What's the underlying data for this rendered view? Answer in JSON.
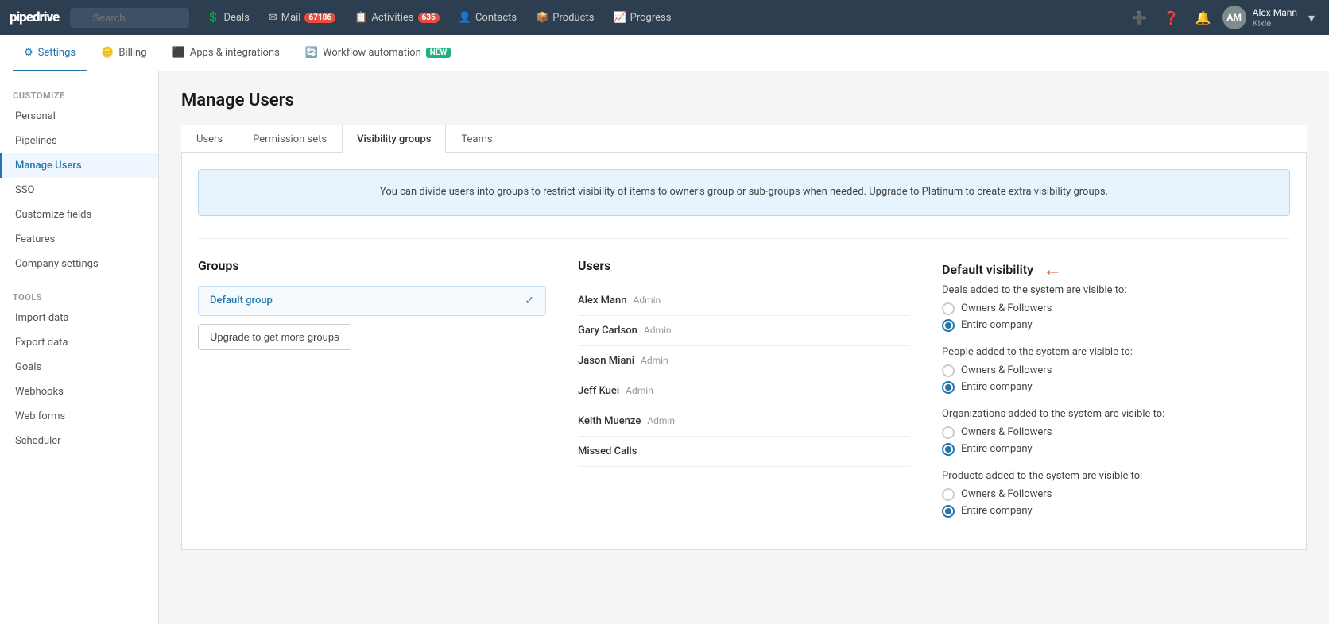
{
  "topNav": {
    "logo": "pipedrive",
    "search": {
      "placeholder": "Search"
    },
    "navItems": [
      {
        "id": "deals",
        "label": "Deals",
        "icon": "dollar-icon",
        "badge": null
      },
      {
        "id": "mail",
        "label": "Mail",
        "icon": "mail-icon",
        "badge": "67186",
        "badgeColor": "red"
      },
      {
        "id": "activities",
        "label": "Activities",
        "icon": "activities-icon",
        "badge": "635",
        "badgeColor": "red"
      },
      {
        "id": "contacts",
        "label": "Contacts",
        "icon": "contacts-icon",
        "badge": null
      },
      {
        "id": "products",
        "label": "Products",
        "icon": "products-icon",
        "badge": null
      },
      {
        "id": "progress",
        "label": "Progress",
        "icon": "progress-icon",
        "badge": null
      }
    ],
    "user": {
      "name": "Alex Mann",
      "sub": "Kixie",
      "initials": "AM"
    }
  },
  "settingsBar": {
    "items": [
      {
        "id": "settings",
        "label": "Settings",
        "icon": "gear-icon",
        "active": true
      },
      {
        "id": "billing",
        "label": "Billing",
        "icon": "billing-icon",
        "active": false
      },
      {
        "id": "apps",
        "label": "Apps & integrations",
        "icon": "apps-icon",
        "active": false
      },
      {
        "id": "workflow",
        "label": "Workflow automation",
        "icon": "workflow-icon",
        "active": false,
        "badge": "NEW"
      }
    ]
  },
  "sidebar": {
    "sections": [
      {
        "label": "CUSTOMIZE",
        "items": [
          {
            "id": "personal",
            "label": "Personal",
            "active": false
          },
          {
            "id": "pipelines",
            "label": "Pipelines",
            "active": false
          },
          {
            "id": "manage-users",
            "label": "Manage Users",
            "active": true
          },
          {
            "id": "sso",
            "label": "SSO",
            "active": false
          },
          {
            "id": "customize-fields",
            "label": "Customize fields",
            "active": false
          },
          {
            "id": "features",
            "label": "Features",
            "active": false
          },
          {
            "id": "company-settings",
            "label": "Company settings",
            "active": false
          }
        ]
      },
      {
        "label": "TOOLS",
        "items": [
          {
            "id": "import-data",
            "label": "Import data",
            "active": false
          },
          {
            "id": "export-data",
            "label": "Export data",
            "active": false
          },
          {
            "id": "goals",
            "label": "Goals",
            "active": false
          },
          {
            "id": "webhooks",
            "label": "Webhooks",
            "active": false
          },
          {
            "id": "web-forms",
            "label": "Web forms",
            "active": false
          },
          {
            "id": "scheduler",
            "label": "Scheduler",
            "active": false
          }
        ]
      }
    ]
  },
  "manageUsers": {
    "title": "Manage Users",
    "tabs": [
      {
        "id": "users",
        "label": "Users",
        "active": false
      },
      {
        "id": "permission-sets",
        "label": "Permission sets",
        "active": false
      },
      {
        "id": "visibility-groups",
        "label": "Visibility groups",
        "active": true
      },
      {
        "id": "teams",
        "label": "Teams",
        "active": false
      }
    ],
    "infoBox": "You can divide users into groups to restrict visibility of items to owner's group or sub-groups when needed. Upgrade to Platinum to create extra visibility groups.",
    "groups": {
      "title": "Groups",
      "defaultGroup": "Default group",
      "upgradeBtn": "Upgrade to get more groups"
    },
    "users": {
      "title": "Users",
      "list": [
        {
          "name": "Alex Mann",
          "role": "Admin"
        },
        {
          "name": "Gary Carlson",
          "role": "Admin"
        },
        {
          "name": "Jason Miani",
          "role": "Admin"
        },
        {
          "name": "Jeff Kuei",
          "role": "Admin"
        },
        {
          "name": "Keith Muenze",
          "role": "Admin"
        },
        {
          "name": "Missed Calls",
          "role": ""
        }
      ]
    },
    "defaultVisibility": {
      "title": "Default visibility",
      "groups": [
        {
          "label": "Deals added to the system are visible to:",
          "options": [
            {
              "label": "Owners & Followers",
              "selected": false
            },
            {
              "label": "Entire company",
              "selected": true
            }
          ]
        },
        {
          "label": "People added to the system are visible to:",
          "options": [
            {
              "label": "Owners & Followers",
              "selected": false
            },
            {
              "label": "Entire company",
              "selected": true
            }
          ]
        },
        {
          "label": "Organizations added to the system are visible to:",
          "options": [
            {
              "label": "Owners & Followers",
              "selected": false
            },
            {
              "label": "Entire company",
              "selected": true
            }
          ]
        },
        {
          "label": "Products added to the system are visible to:",
          "options": [
            {
              "label": "Owners & Followers",
              "selected": false
            },
            {
              "label": "Entire company",
              "selected": true
            }
          ]
        }
      ]
    }
  }
}
